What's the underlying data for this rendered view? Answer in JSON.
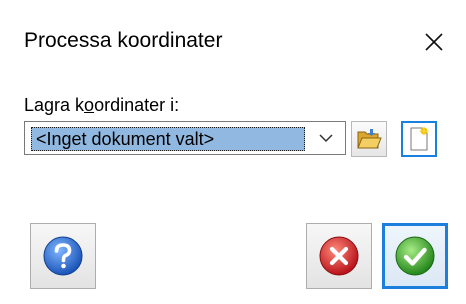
{
  "dialog": {
    "title": "Processa koordinater",
    "close_icon": "close-icon"
  },
  "field": {
    "label_pre": "Lagra k",
    "label_hotkey": "o",
    "label_post": "ordinater i:",
    "selected_value": "<Inget dokument valt>",
    "dropdown_icon": "chevron-down-icon"
  },
  "toolbar": {
    "browse_icon": "folder-open-icon",
    "new_icon": "new-document-icon"
  },
  "buttons": {
    "help_icon": "help-icon",
    "cancel_icon": "cancel-icon",
    "ok_icon": "ok-check-icon"
  },
  "colors": {
    "selection": "#90b8e0",
    "focus_border": "#1d7fdc",
    "help_blue": "#2a6fd6",
    "cancel_red": "#d8262a",
    "ok_green": "#3fae2a"
  }
}
